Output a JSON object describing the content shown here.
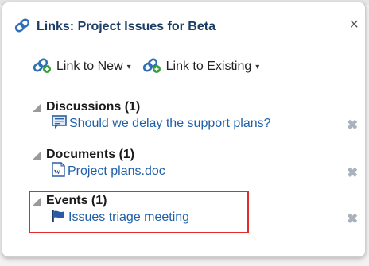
{
  "dialog": {
    "title": "Links: Project Issues for Beta",
    "close_label": "×"
  },
  "toolbar": {
    "link_new_label": "Link to New",
    "link_existing_label": "Link to Existing",
    "caret": "▾"
  },
  "sections": [
    {
      "heading": "Discussions (1)",
      "items": [
        {
          "label": "Should we delay the support plans?",
          "icon": "discussion-icon"
        }
      ]
    },
    {
      "heading": "Documents (1)",
      "items": [
        {
          "label": "Project plans.doc",
          "icon": "word-document-icon"
        }
      ]
    },
    {
      "heading": "Events (1)",
      "items": [
        {
          "label": "Issues triage meeting",
          "icon": "flag-icon"
        }
      ]
    }
  ],
  "delete_glyph": "✖",
  "colors": {
    "link": "#1f5fa8",
    "title": "#1c3d66",
    "highlight": "#e32b2b"
  }
}
